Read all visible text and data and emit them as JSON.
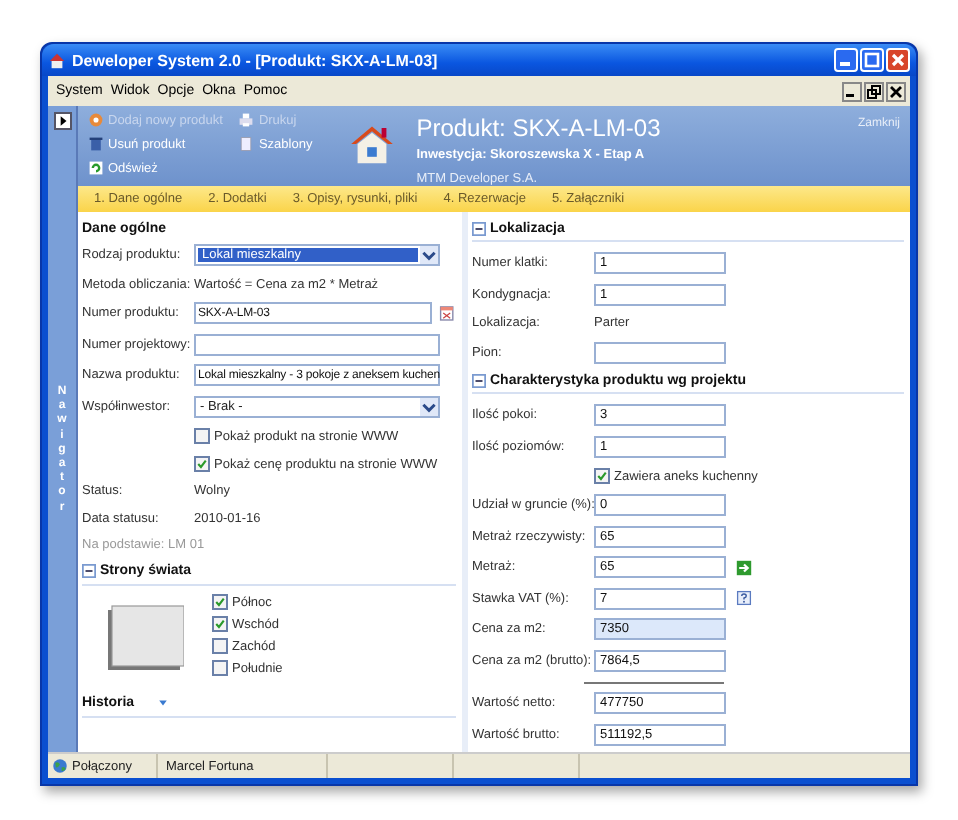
{
  "window": {
    "title": "Deweloper System 2.0 - [Produkt: SKX-A-LM-03]"
  },
  "menu": [
    "System",
    "Widok",
    "Opcje",
    "Okna",
    "Pomoc"
  ],
  "navigator": {
    "label": "Nawigator"
  },
  "header": {
    "actions": [
      {
        "label": "Dodaj nowy produkt",
        "disabled": true
      },
      {
        "label": "Usuń produkt",
        "disabled": false
      },
      {
        "label": "Odśwież",
        "disabled": false
      }
    ],
    "actions_2": [
      {
        "label": "Drukuj",
        "disabled": true
      },
      {
        "label": "Szablony",
        "disabled": false
      }
    ],
    "title": "Produkt: SKX-A-LM-03",
    "subtitle": "Inwestycja: Skoroszewska X - Etap A",
    "company": "MTM Developer S.A.",
    "close": "Zamknij"
  },
  "tabs": [
    {
      "label": "1. Dane ogólne",
      "selected": false
    },
    {
      "label": "2. Dodatki",
      "selected": false
    },
    {
      "label": "3. Opisy, rysunki, pliki",
      "selected": false
    },
    {
      "label": "4. Rezerwacje",
      "selected": false
    },
    {
      "label": "5. Załączniki",
      "selected": false
    }
  ],
  "general": {
    "title": "Dane ogólne",
    "fields": [
      {
        "kind": "select",
        "label": "Rodzaj produktu:",
        "value": "Lokal mieszkalny",
        "highlighted": true
      },
      {
        "kind": "text",
        "label": "Metoda obliczania:",
        "value": "Wartość = Cena za m2 * Metraż"
      },
      {
        "kind": "input-pick",
        "label": "Numer produktu:",
        "value": "SKX-A-LM-03"
      },
      {
        "kind": "input",
        "label": "Numer projektowy:"
      },
      {
        "kind": "input",
        "label": "Nazwa produktu:",
        "value": "Lokal mieszkalny - 3 pokoje z aneksem kuchen"
      },
      {
        "kind": "select",
        "label": "Współinwestor:",
        "value": "- Brak -",
        "highlighted": false
      },
      {
        "kind": "checkbox",
        "label": "Pokaż produkt na stronie WWW",
        "checked": false
      },
      {
        "kind": "checkbox",
        "label": "Pokaż cenę produktu na stronie WWW",
        "checked": true
      },
      {
        "kind": "text",
        "label": "Status:",
        "value": "Wolny"
      },
      {
        "kind": "text",
        "label": "Data statusu:",
        "value": "2010-01-16"
      },
      {
        "kind": "note",
        "label": "Na podstawie: LM 01"
      }
    ]
  },
  "directions": {
    "title": "Strony świata",
    "expanded": true,
    "items": [
      {
        "label": "Północ",
        "checked": true
      },
      {
        "label": "Wschód",
        "checked": true
      },
      {
        "label": "Zachód",
        "checked": false
      },
      {
        "label": "Południe",
        "checked": false
      }
    ]
  },
  "history": {
    "title": "Historia",
    "expanded": false
  },
  "location": {
    "title": "Lokalizacja",
    "expanded": true,
    "fields": [
      {
        "kind": "input",
        "label": "Numer klatki:",
        "value": "1"
      },
      {
        "kind": "input",
        "label": "Kondygnacja:",
        "value": "1"
      },
      {
        "kind": "text",
        "label": "Lokalizacja:",
        "value": "Parter"
      },
      {
        "kind": "input",
        "label": "Pion:"
      }
    ]
  },
  "features": {
    "title": "Charakterystyka produktu wg projektu",
    "expanded": true,
    "fields": [
      {
        "kind": "input",
        "label": "Ilość pokoi:",
        "value": "3"
      },
      {
        "kind": "input",
        "label": "Ilość poziomów:",
        "value": "1"
      },
      {
        "kind": "checkbox",
        "label": "Zawiera aneks kuchenny",
        "checked": true
      },
      {
        "kind": "input",
        "label": "Udział w gruncie (%):",
        "value": "0"
      },
      {
        "kind": "input",
        "label": "Metraż rzeczywisty:",
        "value": "65"
      },
      {
        "kind": "input-arrow",
        "label": "Metraż:",
        "value": "65"
      },
      {
        "kind": "input-help",
        "label": "Stawka VAT (%):",
        "value": "7"
      },
      {
        "kind": "input",
        "label": "Cena za m2:",
        "value": "7350",
        "highlighted": true
      },
      {
        "kind": "input",
        "label": "Cena za m2 (brutto):",
        "value": "7864,5"
      },
      {
        "kind": "separator"
      },
      {
        "kind": "input",
        "label": "Wartość netto:",
        "value": "477750"
      },
      {
        "kind": "input",
        "label": "Wartość brutto:",
        "value": "511192,5"
      }
    ]
  },
  "status_bar": {
    "connection": "Połączony",
    "user": "Marcel Fortuna"
  }
}
